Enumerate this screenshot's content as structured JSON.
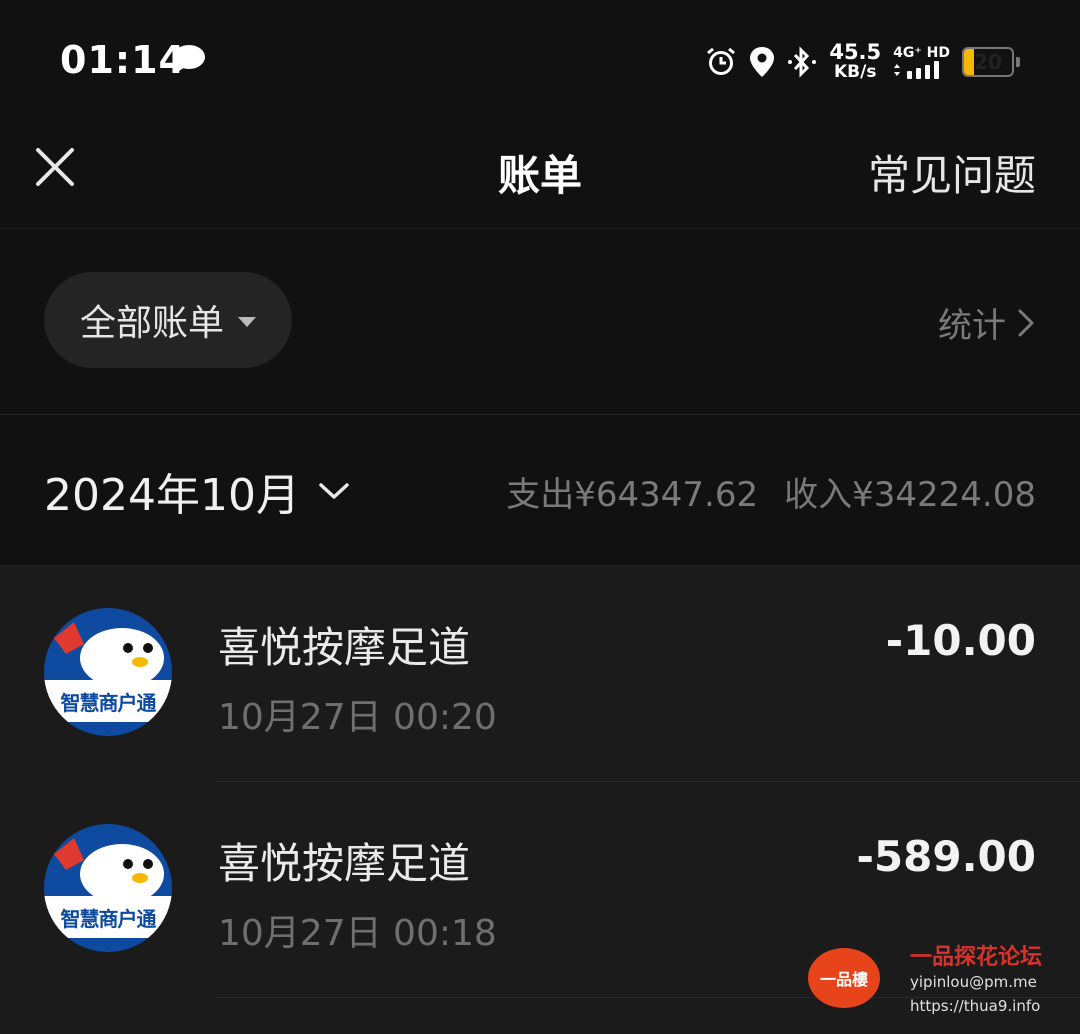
{
  "status_bar": {
    "time": "01:14",
    "speed_value": "45.5",
    "speed_unit": "KB/s",
    "network_type": "4G⁺ HD",
    "battery_level": "20",
    "battery_fraction": 0.2,
    "icons": [
      "message-icon",
      "alarm-icon",
      "location-icon",
      "bluetooth-icon",
      "signal-icon",
      "battery-icon"
    ]
  },
  "header": {
    "title": "账单",
    "faq_label": "常见问题",
    "close_icon": "close-icon"
  },
  "filter": {
    "label": "全部账单",
    "stats_label": "统计"
  },
  "month": {
    "label": "2024年10月",
    "expense": "支出¥64347.62",
    "income": "收入¥34224.08"
  },
  "transactions": [
    {
      "merchant": "喜悦按摩足道",
      "datetime": "10月27日 00:20",
      "amount": "-10.00",
      "avatar_label": "智慧商户通"
    },
    {
      "merchant": "喜悦按摩足道",
      "datetime": "10月27日 00:18",
      "amount": "-589.00",
      "avatar_label": "智慧商户通"
    }
  ],
  "watermark": {
    "logo_text": "一品樓",
    "title": "一品探花论坛",
    "email": "yipinlou@pm.me",
    "url": "https://thua9.info"
  },
  "colors": {
    "background": "#111111",
    "list_background": "#1b1b1b",
    "battery": "#f5b800",
    "avatar": "#0e4aa0"
  }
}
